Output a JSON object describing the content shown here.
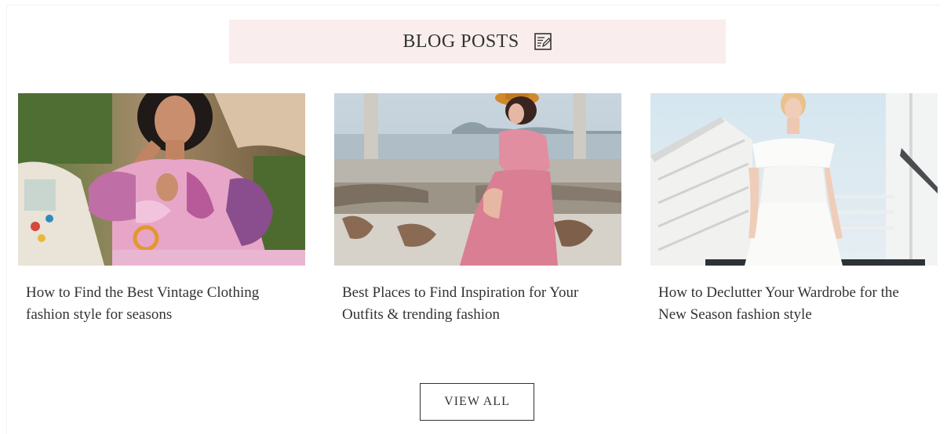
{
  "section": {
    "heading": "BLOG POSTS",
    "heading_icon": "note-edit-icon"
  },
  "posts": [
    {
      "title": "How to Find the Best Vintage Clothing fashion style for seasons",
      "image": "woman-pink-floral-dress-photo"
    },
    {
      "title": "Best Places to Find Inspiration for Your Outfits & trending fashion",
      "image": "woman-pink-dress-seaside-wall-photo"
    },
    {
      "title": "How to Declutter Your Wardrobe for the New Season fashion style",
      "image": "woman-white-dress-stairs-photo"
    }
  ],
  "actions": {
    "view_all_label": "VIEW ALL"
  },
  "colors": {
    "banner_bg": "#f9eded",
    "text": "#333333",
    "border": "#333333"
  }
}
